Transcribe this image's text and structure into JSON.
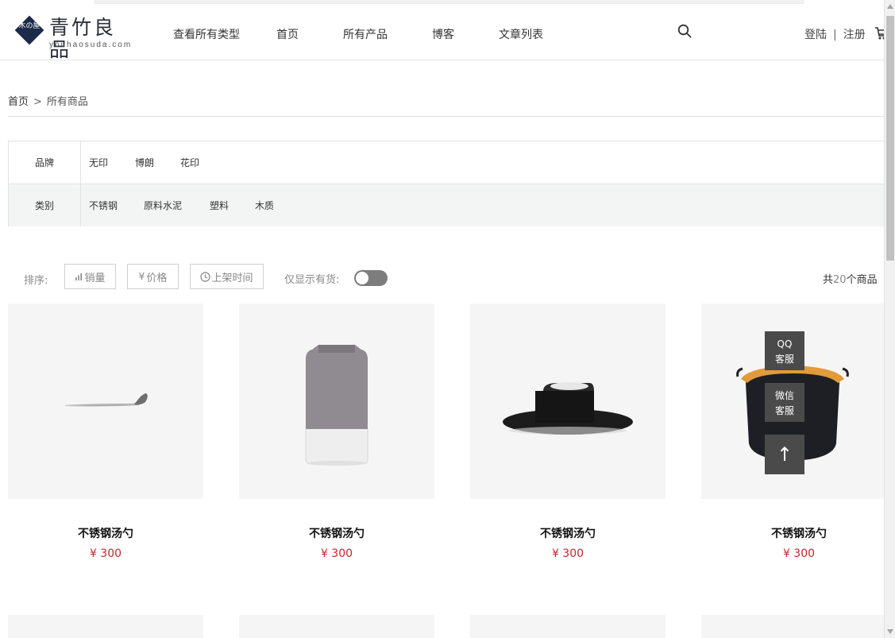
{
  "header": {
    "logo_seal": "木の屋",
    "brand": "青竹良品",
    "brand_sub": "youhaosuda.com",
    "nav": [
      "查看所有类型",
      "首页",
      "所有产品",
      "博客",
      "文章列表"
    ],
    "login": "登陆",
    "separator": "|",
    "register": "注册"
  },
  "breadcrumb": {
    "home": "首页",
    "sep": ">",
    "current": "所有商品"
  },
  "filters": {
    "brand_label": "品牌",
    "brands": [
      "无印",
      "博朗",
      "花印"
    ],
    "category_label": "类别",
    "categories": [
      "不锈钢",
      "原料水泥",
      "塑料",
      "木质"
    ]
  },
  "sort": {
    "label": "排序:",
    "sales": "销量",
    "price": "价格",
    "time": "上架时间",
    "stock_label": "仅显示有货:",
    "stock_only": false,
    "count_prefix": "共",
    "count": "20",
    "count_suffix": "个商品"
  },
  "products": [
    {
      "name": "不锈钢汤勺",
      "price": "¥ 300"
    },
    {
      "name": "不锈钢汤勺",
      "price": "¥ 300"
    },
    {
      "name": "不锈钢汤勺",
      "price": "¥ 300"
    },
    {
      "name": "不锈钢汤勺",
      "price": "¥ 300"
    }
  ],
  "service": {
    "qq_line1": "QQ",
    "qq_line2": "客服",
    "wx_line1": "微信",
    "wx_line2": "客服",
    "top": "↑"
  },
  "colors": {
    "price": "#c2272d",
    "service_bg": "#4a4a4a",
    "toggle_off": "#7d7d7d",
    "filter_alt_bg": "#f3f5f4"
  }
}
